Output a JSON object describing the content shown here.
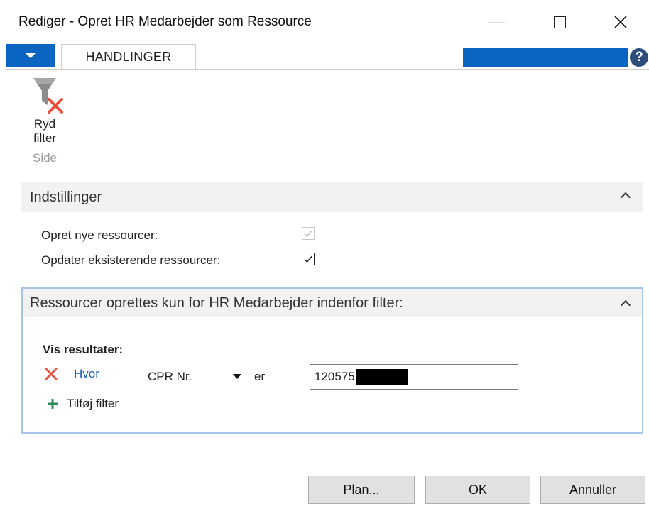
{
  "window": {
    "title": "Rediger - Opret HR Medarbejder som Ressource"
  },
  "ribbon": {
    "tab_label": "HANDLINGER",
    "help_glyph": "?",
    "clear_filter_label_line1": "Ryd",
    "clear_filter_label_line2": "filter",
    "group_label": "Side"
  },
  "settings": {
    "header": "Indstillinger",
    "create_new_label": "Opret nye ressourcer:",
    "create_new_checked": true,
    "create_new_enabled": false,
    "update_existing_label": "Opdater eksisterende ressourcer:",
    "update_existing_checked": true
  },
  "filter_section": {
    "header": "Ressourcer oprettes kun for HR Medarbejder indenfor filter:",
    "show_results_label": "Vis resultater:",
    "where_label": "Hvor",
    "field_name": "CPR Nr.",
    "operator": "er",
    "value": "120575",
    "add_filter_label": "Tilføj filter"
  },
  "footer": {
    "plan_label": "Plan...",
    "ok_label": "OK",
    "cancel_label": "Annuller"
  },
  "colors": {
    "accent_blue": "#0a64c2",
    "clear_x_red": "#e8503a",
    "add_green": "#2e8b57",
    "link_blue": "#1a5fb4"
  }
}
